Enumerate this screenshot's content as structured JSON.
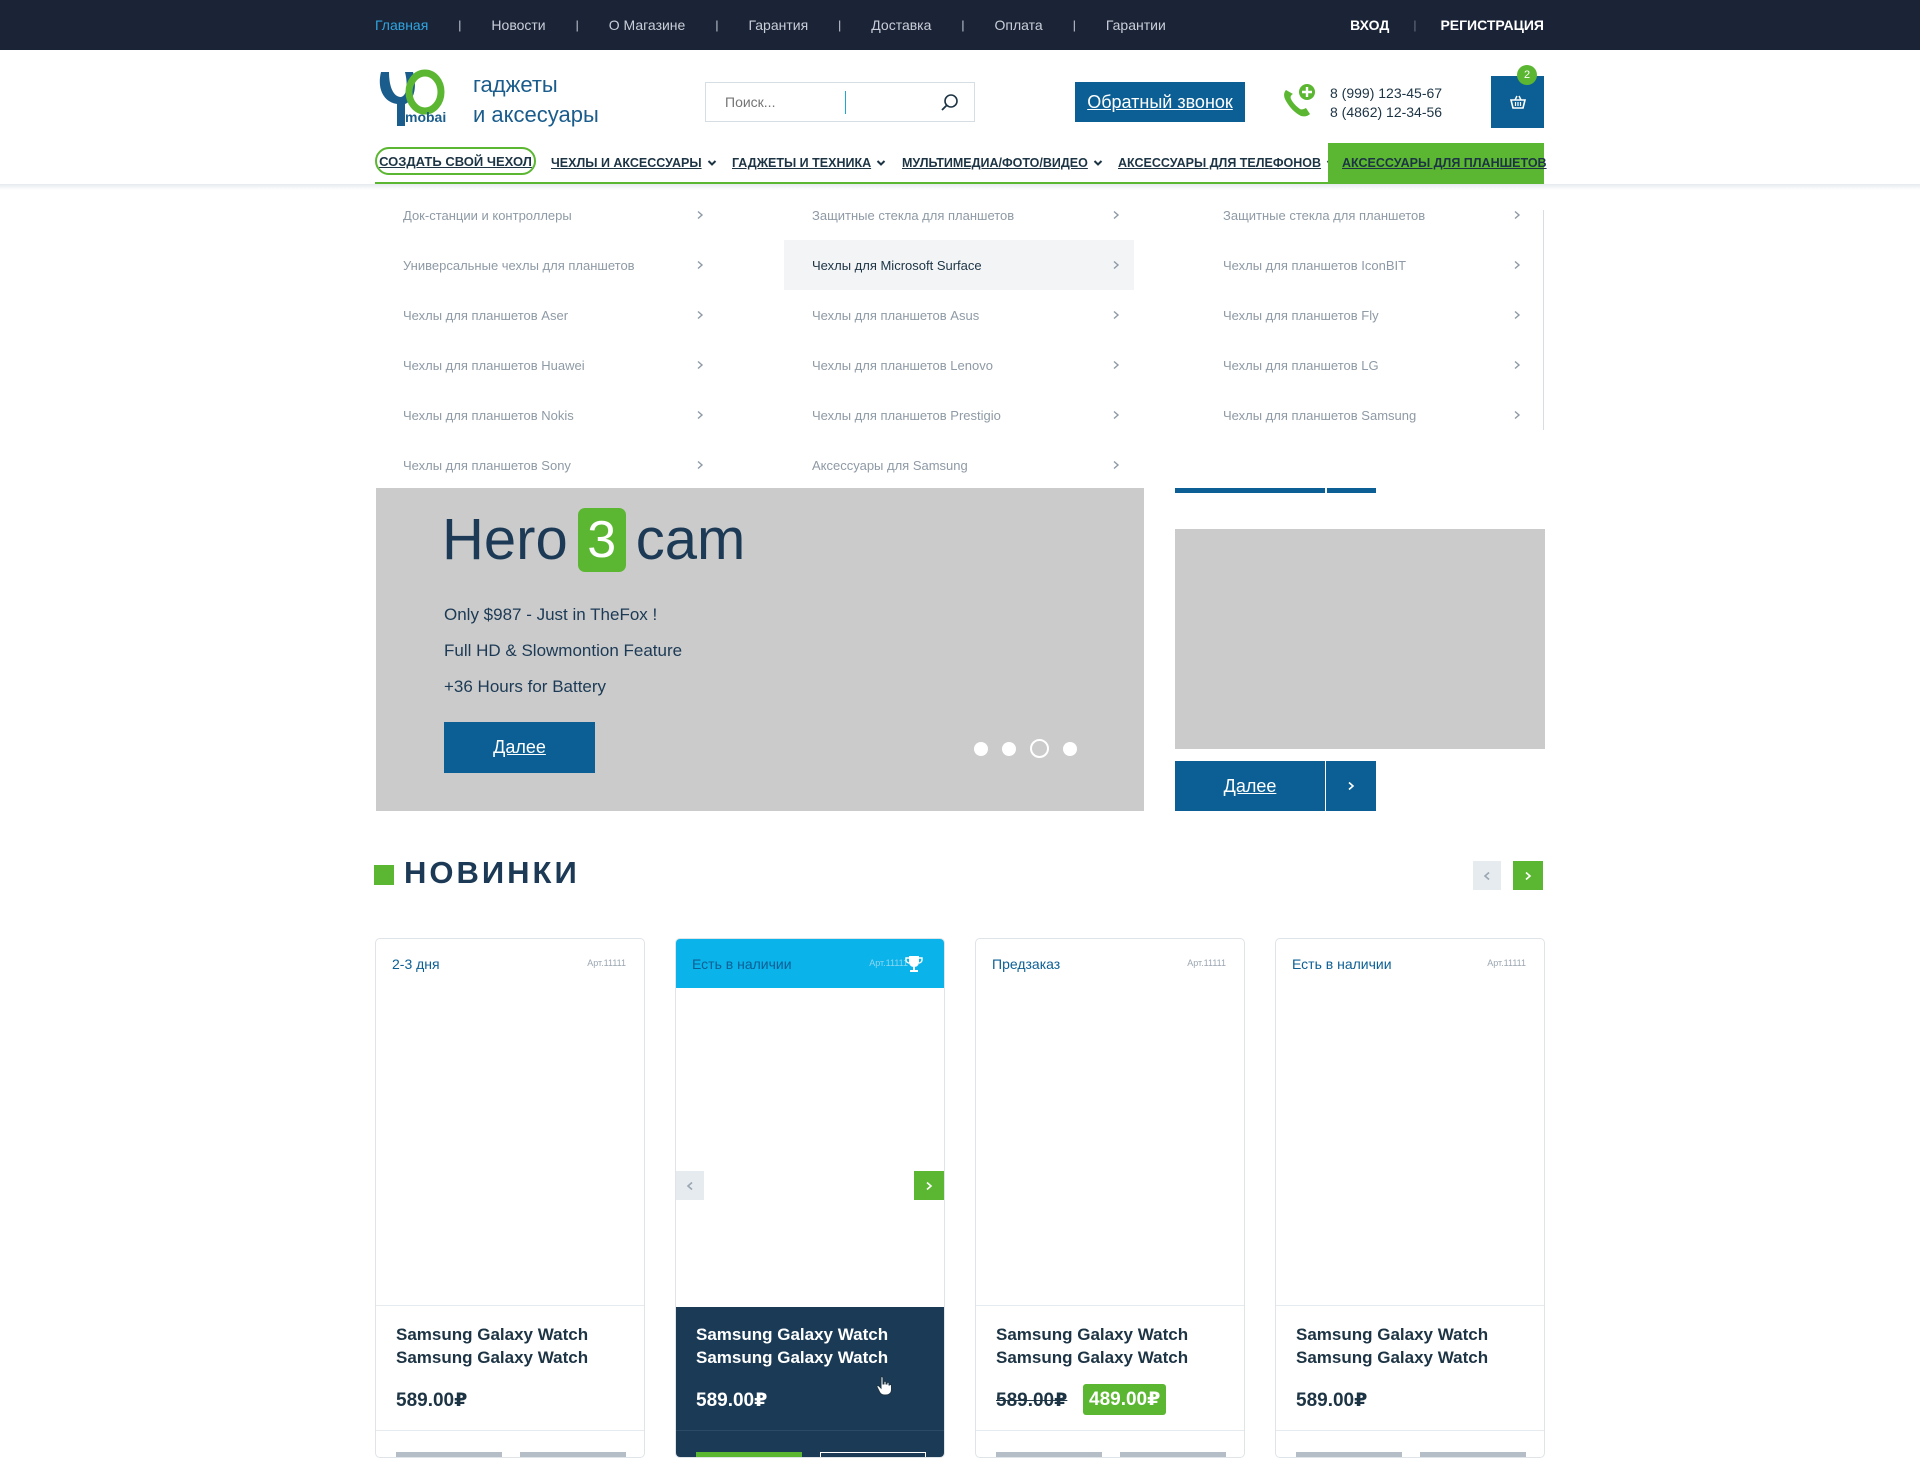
{
  "topbar": {
    "nav": [
      {
        "label": "Главная",
        "active": true
      },
      {
        "label": "Новости"
      },
      {
        "label": "О Магазине"
      },
      {
        "label": "Гарантия"
      },
      {
        "label": "Доставка"
      },
      {
        "label": "Оплата"
      },
      {
        "label": "Гарантии"
      }
    ],
    "login": "ВХОД",
    "register": "РЕГИСТРАЦИЯ"
  },
  "header": {
    "logo_icon": "logo-mark-icon",
    "logo_text": "mobail",
    "tagline_line1": "гаджеты",
    "tagline_line2": "и аксесуары",
    "search_placeholder": "Поиск...",
    "search_icon": "search-icon",
    "callback_label": "Обратный звонок",
    "phone_icon": "phone-plus-icon",
    "phone1": "8 (999) 123-45-67",
    "phone2": "8 (4862) 12-34-56",
    "cart_icon": "basket-icon",
    "cart_count": "2"
  },
  "catnav": {
    "create_label": "СОЗДАТЬ СВОЙ ЧЕХОЛ",
    "items": [
      {
        "label": "ЧЕХЛЫ И АКСЕССУАРЫ"
      },
      {
        "label": "ГАДЖЕТЫ И ТЕХНИКА"
      },
      {
        "label": "МУЛЬТИМЕДИА/ФОТО/ВИДЕО"
      },
      {
        "label": "АКСЕССУАРЫ ДЛЯ ТЕЛЕФОНОВ"
      },
      {
        "label": "АКСЕССУАРЫ ДЛЯ ПЛАНШЕТОВ",
        "active": true
      }
    ]
  },
  "megamenu": {
    "columns": [
      [
        "Док-станции и контроллеры",
        "Универсальные чехлы для планшетов",
        "Чехлы для планшетов Aser",
        "Чехлы для планшетов Huawei",
        "Чехлы для планшетов Nokis",
        "Чехлы для планшетов Sony"
      ],
      [
        "Защитные стекла для планшетов",
        "Чехлы для Microsoft Surface",
        "Чехлы для планшетов Asus",
        "Чехлы для планшетов Lenovo",
        "Чехлы для планшетов Prestigio",
        "Аксессуары для Samsung"
      ],
      [
        "Защитные стекла для планшетов",
        "Чехлы для планшетов IconBIT",
        "Чехлы для планшетов Fly",
        "Чехлы для планшетов LG",
        "Чехлы для планшетов Samsung"
      ]
    ],
    "hovered": "Чехлы для Microsoft Surface"
  },
  "hero": {
    "title_before": "Hero",
    "title_number": "3",
    "title_after": "cam",
    "line1": "Only $987 - Just in TheFox !",
    "line2": "Full HD  & Slowmontion Feature",
    "line3": "+36 Hours for Battery",
    "button": "Далее",
    "slide_count": 4,
    "active_slide": 3
  },
  "side_banner": {
    "button": "Далее",
    "next_icon": "chevron-right-icon"
  },
  "section": {
    "title": "НОВИНКИ"
  },
  "products": [
    {
      "status": "2-3 дня",
      "art": "Арт.11111",
      "name": "Samsung Galaxy Watch Samsung Galaxy Watch",
      "price": "589.00₽"
    },
    {
      "status": "Есть в наличии",
      "art": "Арт.11111",
      "name": "Samsung Galaxy Watch Samsung Galaxy Watch",
      "price": "589.00₽",
      "featured": true,
      "badge_icon": "trophy-icon"
    },
    {
      "status": "Предзаказ",
      "art": "Арт.11111",
      "name": "Samsung Galaxy Watch Samsung Galaxy Watch",
      "price_old": "589.00₽",
      "price_new": "489.00₽"
    },
    {
      "status": "Есть в наличии",
      "art": "Арт.11111",
      "name": "Samsung Galaxy Watch Samsung Galaxy Watch",
      "price": "589.00₽"
    }
  ],
  "colors": {
    "topbar_bg": "#1b2436",
    "primary_blue": "#0c5f94",
    "accent_green": "#5bb731",
    "featured_head": "#0ab3ea",
    "featured_info": "#1b3a55",
    "placeholder_gray": "#cbcbcb"
  }
}
